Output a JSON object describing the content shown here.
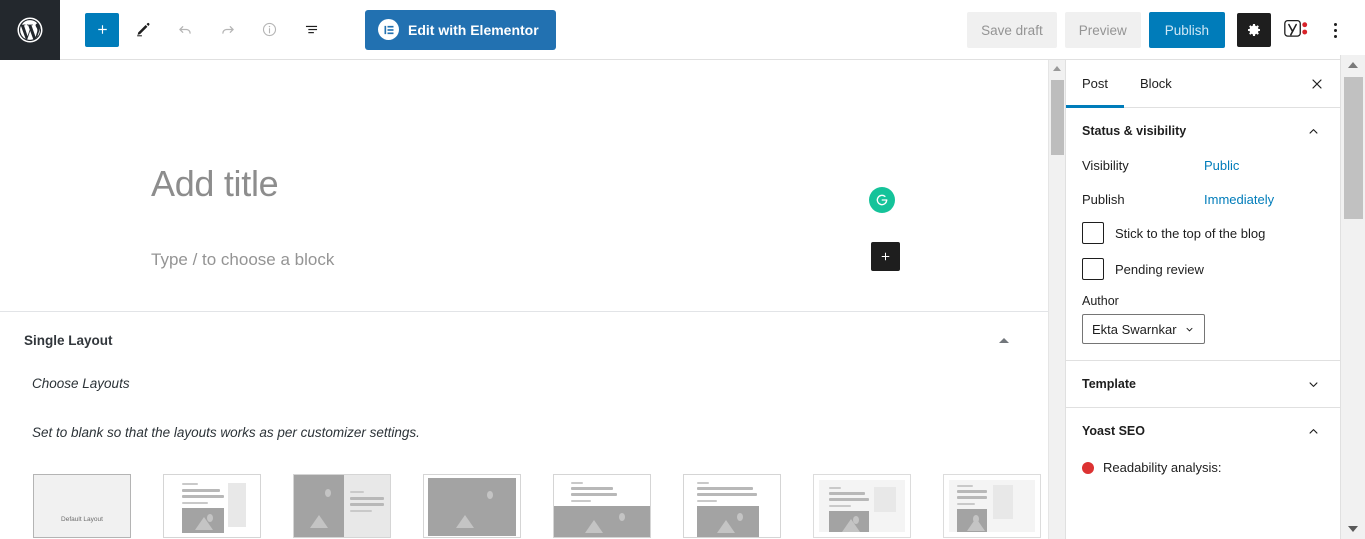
{
  "topbar": {
    "logo_icon": "wordpress-logo-icon",
    "add_block_icon": "plus-icon",
    "edit_tool_icon": "pencil-icon",
    "undo_icon": "undo-arrow-icon",
    "redo_icon": "redo-arrow-icon",
    "info_icon": "info-circle-icon",
    "list_view_icon": "list-view-icon",
    "elementor_label": "Edit with Elementor",
    "elementor_icon": "elementor-logo-icon",
    "save_draft_label": "Save draft",
    "preview_label": "Preview",
    "publish_label": "Publish",
    "settings_icon": "gear-icon",
    "yoast_icon": "yoast-seo-icon",
    "options_icon": "kebab-menu-icon",
    "accent_blue": "#007cba",
    "elementor_blue": "#2271b1"
  },
  "editor": {
    "title_placeholder": "Add title",
    "block_placeholder": "Type / to choose a block",
    "grammarly_icon": "grammarly-icon",
    "grammarly_color": "#15c39a",
    "block_adder_icon": "plus-icon"
  },
  "metabox": {
    "title": "Single Layout",
    "toggle_icon": "triangle-up-icon",
    "choose_label": "Choose Layouts",
    "description": "Set to blank so that the layouts works as per customizer settings.",
    "layouts": [
      {
        "name": "default-layout",
        "label": "Default Layout",
        "selected": true,
        "kind": "blank"
      },
      {
        "name": "layout-text-sidebar",
        "label": "",
        "selected": false,
        "kind": "text-side"
      },
      {
        "name": "layout-image-left",
        "label": "",
        "selected": false,
        "kind": "image-left"
      },
      {
        "name": "layout-full-image",
        "label": "",
        "selected": false,
        "kind": "full-image"
      },
      {
        "name": "layout-title-image",
        "label": "",
        "selected": false,
        "kind": "title-image"
      },
      {
        "name": "layout-title-image-wide",
        "label": "",
        "selected": false,
        "kind": "title-image-wide"
      },
      {
        "name": "layout-framed-sidebar",
        "label": "",
        "selected": false,
        "kind": "framed-side"
      },
      {
        "name": "layout-framed-narrow",
        "label": "",
        "selected": false,
        "kind": "framed-narrow"
      }
    ]
  },
  "sidebar": {
    "tabs": [
      {
        "label": "Post",
        "active": true
      },
      {
        "label": "Block",
        "active": false
      }
    ],
    "close_icon": "close-x-icon",
    "status_section": {
      "title": "Status & visibility",
      "chevron_icon": "chevron-up-icon",
      "visibility_label": "Visibility",
      "visibility_value": "Public",
      "publish_label": "Publish",
      "publish_value": "Immediately",
      "sticky_label": "Stick to the top of the blog",
      "pending_label": "Pending review",
      "author_label": "Author",
      "author_value": "Ekta Swarnkar",
      "author_chevron_icon": "chevron-down-icon"
    },
    "template_section": {
      "title": "Template",
      "chevron_icon": "chevron-down-icon"
    },
    "yoast_section": {
      "title": "Yoast SEO",
      "chevron_icon": "chevron-up-icon",
      "readability_label": "Readability analysis:",
      "readability_status_color": "#dc3232"
    }
  },
  "scrollbars": {
    "inner_up_icon": "scroll-up-arrow-icon",
    "outer_up_icon": "scroll-up-arrow-icon",
    "outer_down_icon": "scroll-down-arrow-icon"
  }
}
